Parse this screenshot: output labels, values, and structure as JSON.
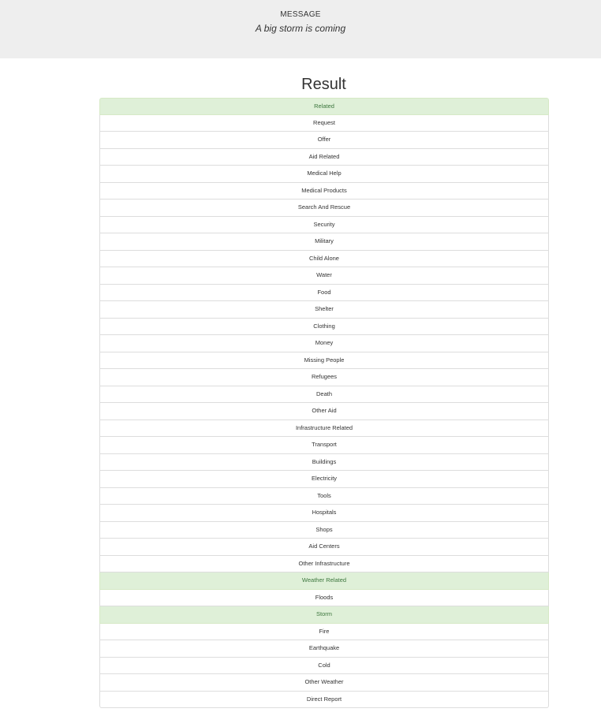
{
  "header": {
    "label": "MESSAGE",
    "message": "A big storm is coming"
  },
  "result": {
    "title": "Result",
    "categories": [
      {
        "label": "Related",
        "active": true
      },
      {
        "label": "Request",
        "active": false
      },
      {
        "label": "Offer",
        "active": false
      },
      {
        "label": "Aid Related",
        "active": false
      },
      {
        "label": "Medical Help",
        "active": false
      },
      {
        "label": "Medical Products",
        "active": false
      },
      {
        "label": "Search And Rescue",
        "active": false
      },
      {
        "label": "Security",
        "active": false
      },
      {
        "label": "Military",
        "active": false
      },
      {
        "label": "Child Alone",
        "active": false
      },
      {
        "label": "Water",
        "active": false
      },
      {
        "label": "Food",
        "active": false
      },
      {
        "label": "Shelter",
        "active": false
      },
      {
        "label": "Clothing",
        "active": false
      },
      {
        "label": "Money",
        "active": false
      },
      {
        "label": "Missing People",
        "active": false
      },
      {
        "label": "Refugees",
        "active": false
      },
      {
        "label": "Death",
        "active": false
      },
      {
        "label": "Other Aid",
        "active": false
      },
      {
        "label": "Infrastructure Related",
        "active": false
      },
      {
        "label": "Transport",
        "active": false
      },
      {
        "label": "Buildings",
        "active": false
      },
      {
        "label": "Electricity",
        "active": false
      },
      {
        "label": "Tools",
        "active": false
      },
      {
        "label": "Hospitals",
        "active": false
      },
      {
        "label": "Shops",
        "active": false
      },
      {
        "label": "Aid Centers",
        "active": false
      },
      {
        "label": "Other Infrastructure",
        "active": false
      },
      {
        "label": "Weather Related",
        "active": true
      },
      {
        "label": "Floods",
        "active": false
      },
      {
        "label": "Storm",
        "active": true
      },
      {
        "label": "Fire",
        "active": false
      },
      {
        "label": "Earthquake",
        "active": false
      },
      {
        "label": "Cold",
        "active": false
      },
      {
        "label": "Other Weather",
        "active": false
      },
      {
        "label": "Direct Report",
        "active": false
      }
    ]
  },
  "colors": {
    "header_bg": "#eeeeee",
    "active_bg": "#dff0d8",
    "active_text": "#3c763d",
    "border": "#dddddd"
  }
}
